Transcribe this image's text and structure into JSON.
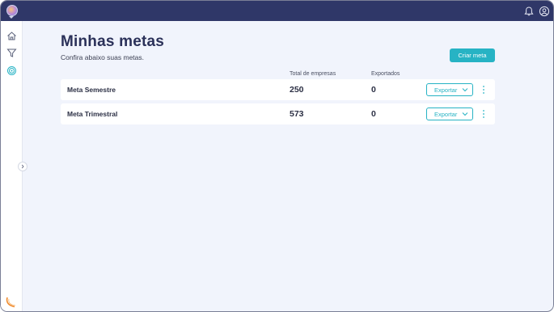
{
  "header": {
    "logo_icon": "avatar-logo",
    "notification_icon": "bell-icon",
    "account_icon": "user-circle-icon"
  },
  "sidebar": {
    "items": [
      {
        "icon": "home-icon"
      },
      {
        "icon": "filter-icon"
      },
      {
        "icon": "target-icon",
        "active": true
      }
    ],
    "expand_icon": "chevron-right-icon"
  },
  "page": {
    "title": "Minhas metas",
    "subtitle": "Confira abaixo suas metas.",
    "create_button": "Criar meta"
  },
  "table": {
    "columns": [
      "Total de empresas",
      "Exportados"
    ],
    "rows": [
      {
        "name": "Meta Semestre",
        "total": "250",
        "exported": "0",
        "export_label": "Exportar"
      },
      {
        "name": "Meta Trimestral",
        "total": "573",
        "exported": "0",
        "export_label": "Exportar"
      }
    ]
  },
  "colors": {
    "topbar": "#2f3768",
    "accent": "#27b3c4",
    "background": "#f1f4fc",
    "title": "#2b3159"
  }
}
